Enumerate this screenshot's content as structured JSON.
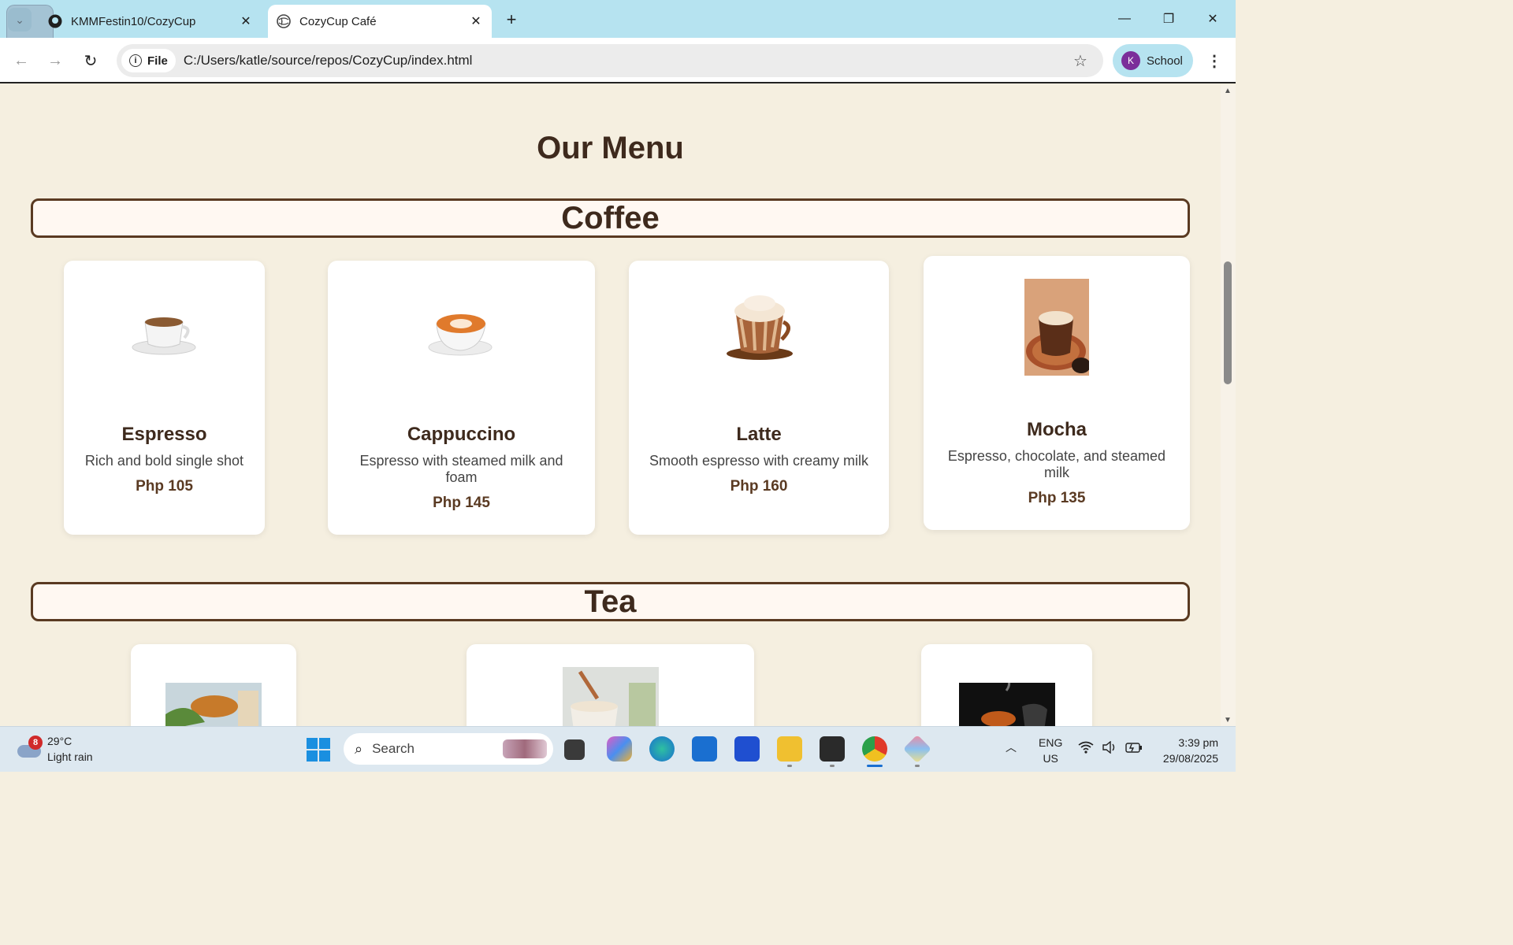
{
  "browser": {
    "tabs": [
      {
        "title": "KMMFestin10/CozyCup",
        "icon": "github-icon"
      },
      {
        "title": "CozyCup Café",
        "icon": "globe-icon"
      }
    ],
    "file_chip": "File",
    "url": "C:/Users/katle/source/repos/CozyCup/index.html",
    "profile": {
      "initial": "K",
      "label": "School"
    }
  },
  "page": {
    "title": "Our Menu",
    "sections": [
      {
        "name": "Coffee",
        "items": [
          {
            "name": "Espresso",
            "desc": "Rich and bold single shot",
            "price": "Php 105"
          },
          {
            "name": "Cappuccino",
            "desc": "Espresso with steamed milk and foam",
            "price": "Php 145"
          },
          {
            "name": "Latte",
            "desc": "Smooth espresso with creamy milk",
            "price": "Php 160"
          },
          {
            "name": "Mocha",
            "desc": "Espresso, chocolate, and steamed milk",
            "price": "Php 135"
          }
        ]
      },
      {
        "name": "Tea",
        "items": []
      }
    ]
  },
  "taskbar": {
    "weather": {
      "badge": "8",
      "temp": "29°C",
      "condition": "Light rain"
    },
    "search_placeholder": "Search",
    "lang": {
      "line1": "ENG",
      "line2": "US"
    },
    "clock": {
      "time": "3:39 pm",
      "date": "29/08/2025"
    }
  },
  "colors": {
    "page_bg": "#f5efe0",
    "heading": "#3e2a1d",
    "border_brown": "#5a3a22",
    "tabbar": "#b6e3f0"
  }
}
